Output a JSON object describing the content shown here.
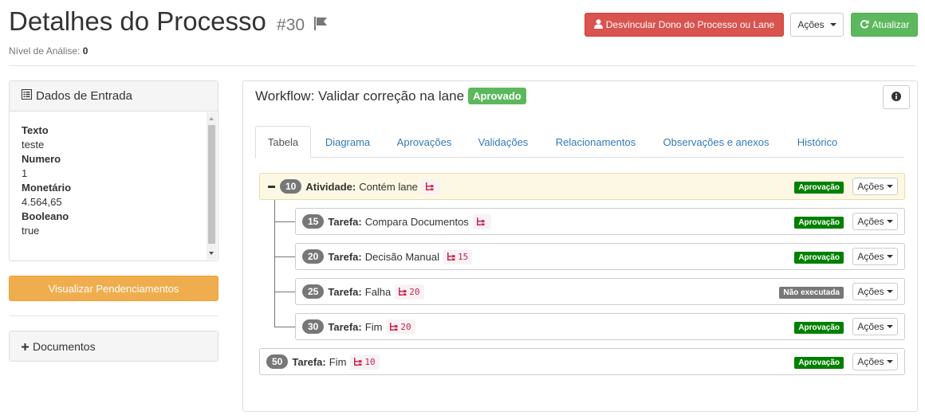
{
  "header": {
    "title": "Detalhes do Processo",
    "process_id": "#30",
    "analysis_label": "Nível de Análise:",
    "analysis_value": "0",
    "unlink_button": "Desvincular Dono do Processo ou Lane",
    "actions_button": "Ações",
    "refresh_button": "Atualizar"
  },
  "input_panel": {
    "title": "Dados de Entrada",
    "fields": [
      {
        "key": "Texto",
        "value": "teste"
      },
      {
        "key": "Numero",
        "value": "1"
      },
      {
        "key": "Monetário",
        "value": "4.564,65"
      },
      {
        "key": "Booleano",
        "value": "true"
      }
    ]
  },
  "pending_button": "Visualizar Pendenciamentos",
  "documents_panel": {
    "title": "Documentos"
  },
  "workflow": {
    "title": "Workflow: Validar correção na lane",
    "status": "Aprovado",
    "tabs": [
      "Tabela",
      "Diagrama",
      "Aprovações",
      "Validações",
      "Relacionamentos",
      "Observações e anexos",
      "Histórico"
    ],
    "active_tab": "Tabela",
    "rows": [
      {
        "id": "10",
        "type": "Atividade:",
        "name": "Contém lane",
        "ref": "",
        "status": "Aprovação",
        "actions": "Ações"
      },
      {
        "id": "15",
        "type": "Tarefa:",
        "name": "Compara Documentos",
        "ref": "",
        "status": "Aprovação",
        "actions": "Ações"
      },
      {
        "id": "20",
        "type": "Tarefa:",
        "name": "Decisão Manual",
        "ref": "15",
        "status": "Aprovação",
        "actions": "Ações"
      },
      {
        "id": "25",
        "type": "Tarefa:",
        "name": "Falha",
        "ref": "20",
        "status": "Não executada",
        "actions": "Ações"
      },
      {
        "id": "30",
        "type": "Tarefa:",
        "name": "Fim",
        "ref": "20",
        "status": "Aprovação",
        "actions": "Ações"
      },
      {
        "id": "50",
        "type": "Tarefa:",
        "name": "Fim",
        "ref": "10",
        "status": "Aprovação",
        "actions": "Ações"
      }
    ]
  },
  "colors": {
    "danger": "#d9534f",
    "success": "#5cb85c",
    "warning": "#f0ad4e",
    "link": "#337ab7",
    "status_approved": "#008000",
    "status_not_executed": "#777777",
    "activity_row_bg": "#fcf8e3"
  },
  "icons": {
    "flag": "flag-icon",
    "user": "user-icon",
    "refresh": "refresh-icon",
    "list": "list-icon",
    "plus": "plus-icon",
    "info": "info-icon",
    "tree": "tree-icon",
    "collapse": "minus-icon"
  }
}
